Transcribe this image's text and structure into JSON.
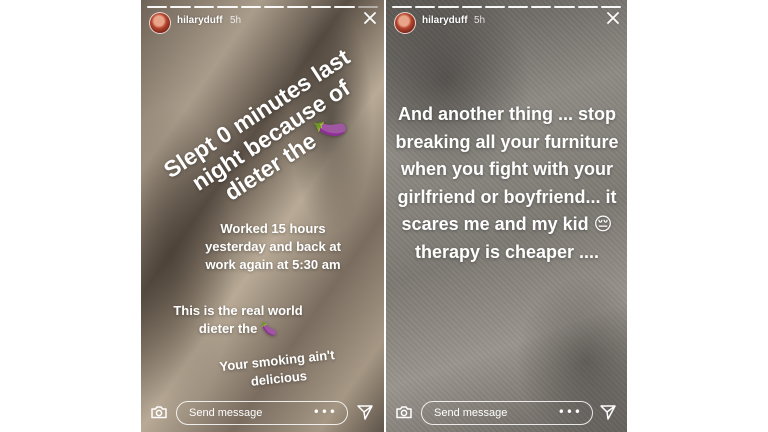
{
  "stories": [
    {
      "username": "hilaryduff",
      "timestamp": "5h",
      "progress": {
        "segments_total": 10,
        "segments_done": 9
      },
      "texts": {
        "rotated": "Slept 0 minutes last night because of dieter the",
        "rotated_emoji": "🍆",
        "worked": "Worked 15 hours yesterday and back at work again at 5:30 am",
        "realworld": "This is the real world dieter the",
        "realworld_emoji": "🍆",
        "smoking": "Your smoking ain't delicious"
      },
      "send_placeholder": "Send message",
      "more_label": "•••"
    },
    {
      "username": "hilaryduff",
      "timestamp": "5h",
      "progress": {
        "segments_total": 10,
        "segments_done": 10
      },
      "texts": {
        "main_part1": "And another thing ... stop breaking all your furniture when you fight with your girlfriend or boyfriend... it scares me and my kid",
        "main_emoji": "😔",
        "main_part2": "therapy is cheaper ...."
      },
      "send_placeholder": "Send message",
      "more_label": "•••"
    }
  ],
  "icons": {
    "close": "close-icon",
    "camera": "camera-icon",
    "send": "paper-plane-icon",
    "more": "more-dots-icon"
  },
  "colors": {
    "text": "#ffffff",
    "progress_done": "#ffffff",
    "progress_pending": "rgba(255,255,255,0.45)"
  }
}
